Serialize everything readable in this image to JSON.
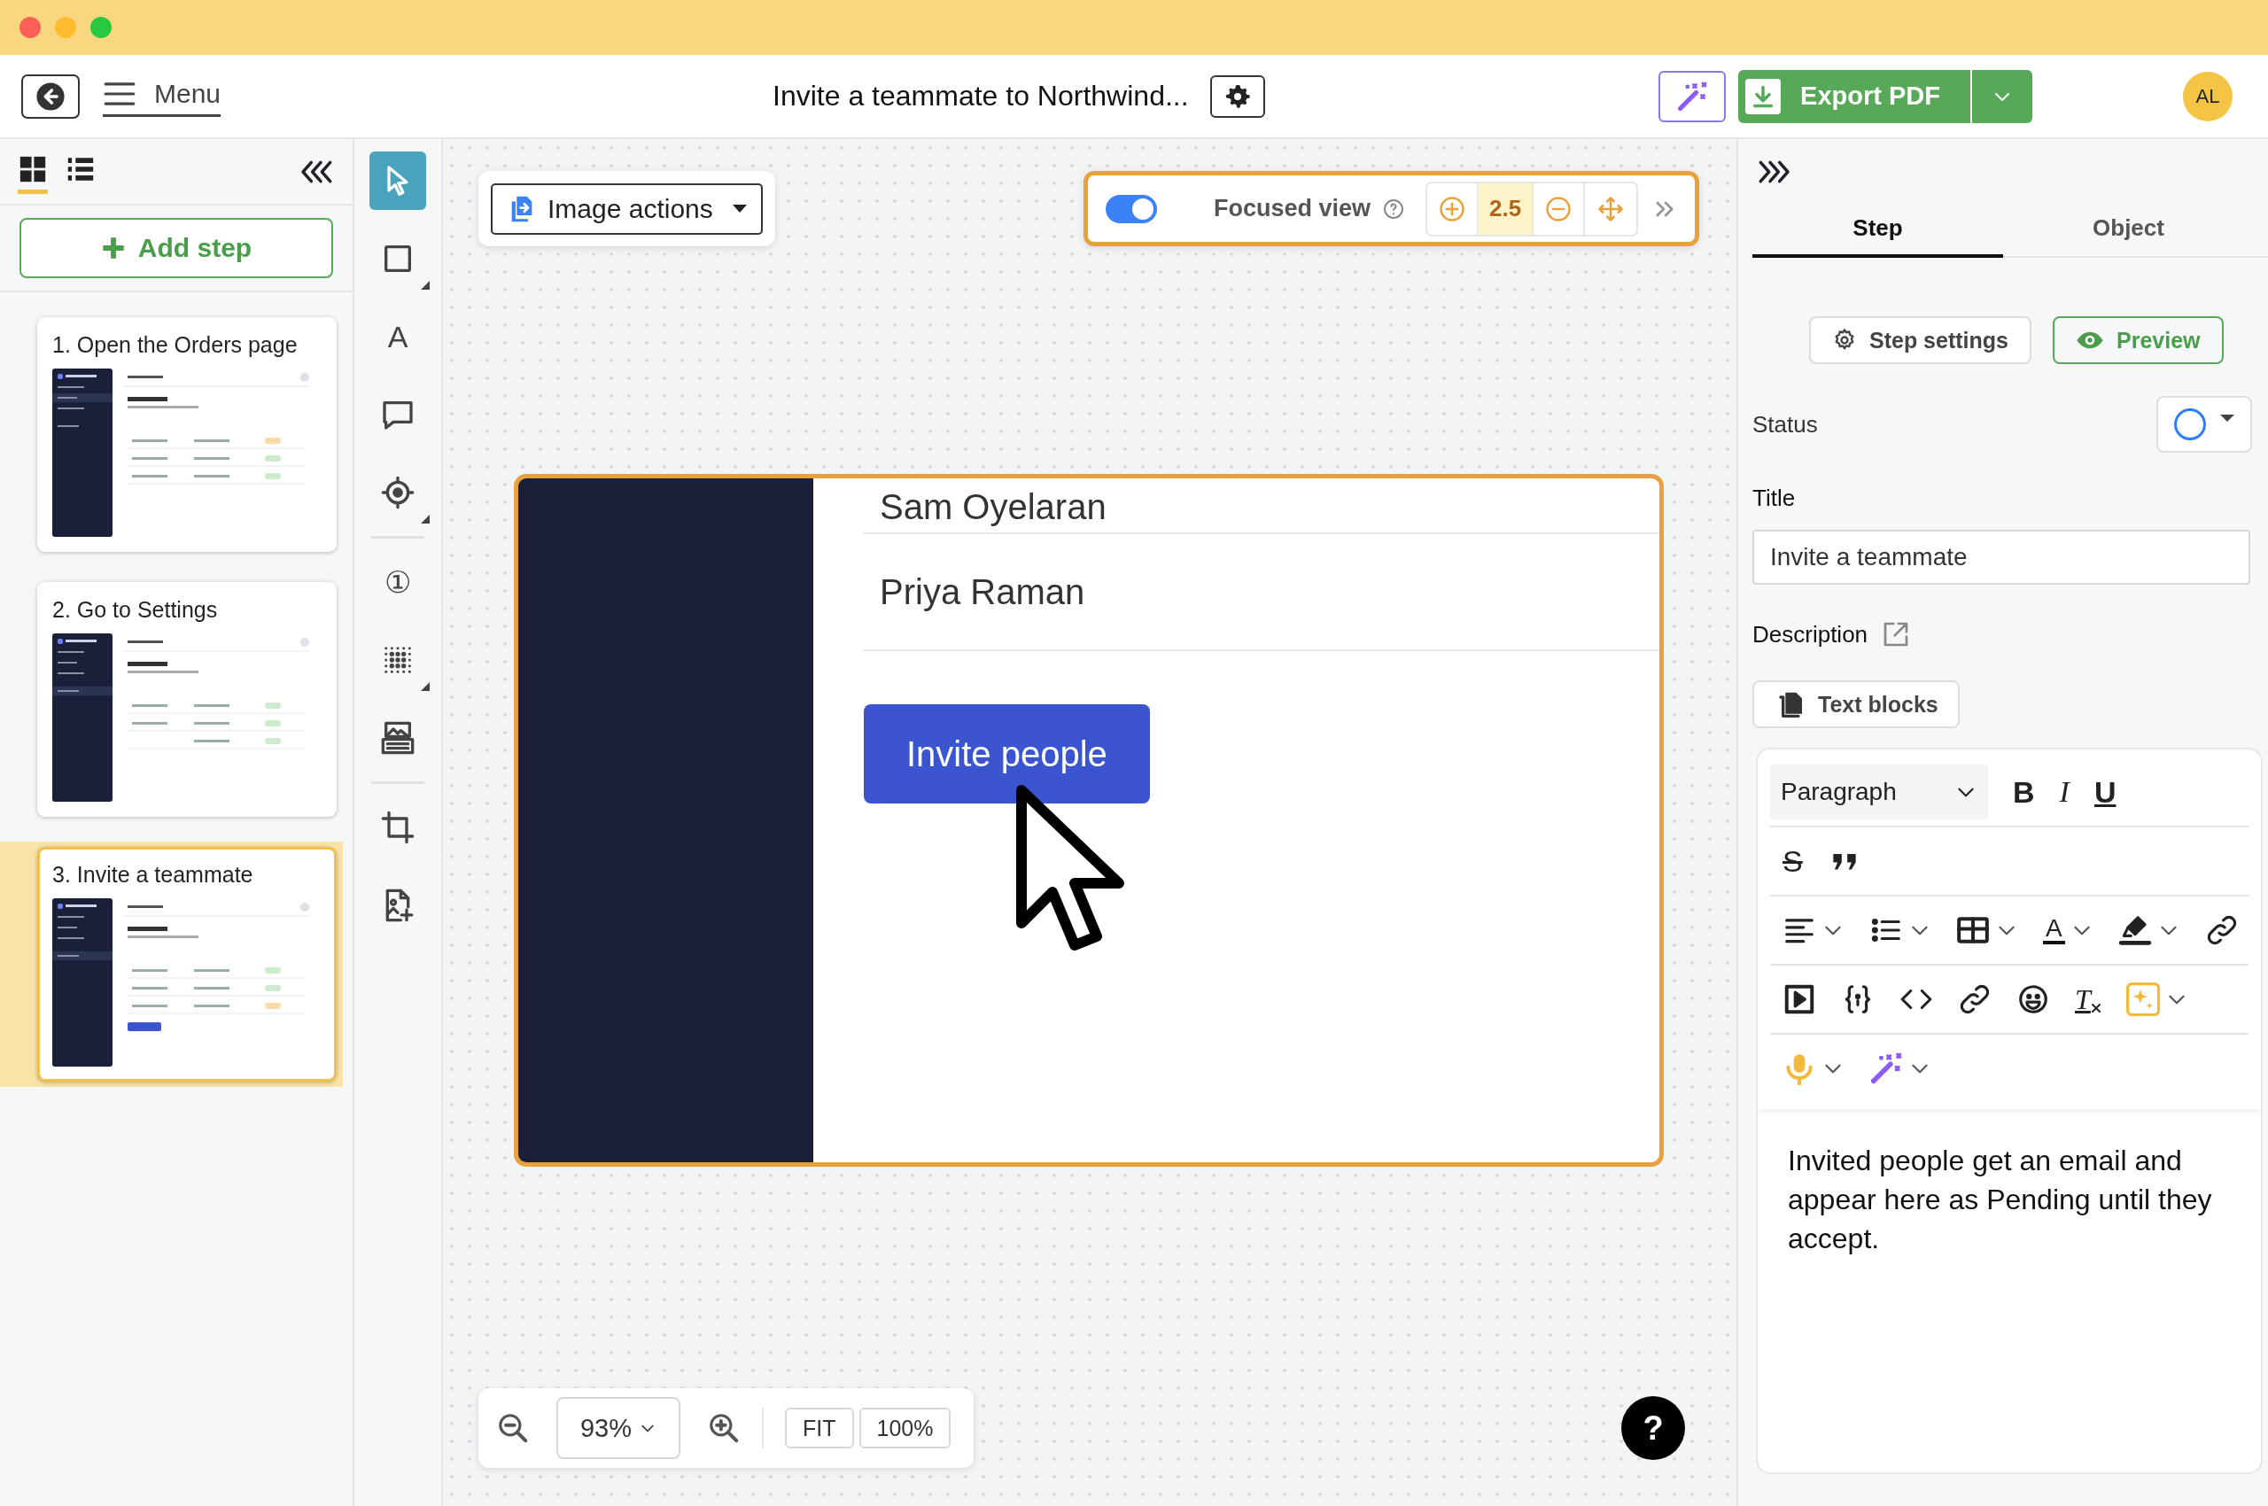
{
  "topbar": {
    "menu_label": "Menu",
    "title": "Invite a teammate to Northwind...",
    "export_label": "Export PDF",
    "avatar": "AL"
  },
  "left_panel": {
    "view_modes": [
      {
        "kind": "grid",
        "selected": true
      },
      {
        "kind": "list",
        "selected": false
      }
    ],
    "add_step": "Add step",
    "steps": [
      {
        "title": "1. Open the Orders page",
        "selected": false
      },
      {
        "title": "2. Go to Settings",
        "selected": false
      },
      {
        "title": "3. Invite a teammate",
        "selected": true
      }
    ]
  },
  "tools": [
    {
      "kind": "select",
      "selected": true,
      "submenu": false
    },
    {
      "kind": "rectangle",
      "selected": false,
      "submenu": true
    },
    {
      "kind": "text",
      "label": "A",
      "selected": false,
      "submenu": false
    },
    {
      "kind": "comment",
      "selected": false,
      "submenu": false
    },
    {
      "kind": "target",
      "selected": false,
      "submenu": true
    },
    {
      "kind": "divider"
    },
    {
      "kind": "step-number",
      "label": "①",
      "selected": false,
      "submenu": false
    },
    {
      "kind": "blur",
      "selected": false,
      "submenu": true
    },
    {
      "kind": "image-caption",
      "selected": false,
      "submenu": false
    },
    {
      "kind": "divider"
    },
    {
      "kind": "crop",
      "selected": false,
      "submenu": false
    },
    {
      "kind": "add-image",
      "selected": false,
      "submenu": false
    }
  ],
  "canvas": {
    "image_actions": "Image actions",
    "focused_view": {
      "on": true,
      "label": "Focused view",
      "zoom": "2.5"
    },
    "image": {
      "rows": [
        "Sam Oyelaran",
        "Priya Raman"
      ],
      "button": "Invite people"
    },
    "zoom_bar": {
      "zoom": "93%",
      "fit": "FIT",
      "full": "100%"
    },
    "help": "?"
  },
  "right_panel": {
    "tabs": [
      {
        "label": "Step",
        "selected": true
      },
      {
        "label": "Object",
        "selected": false
      }
    ],
    "step_settings": "Step settings",
    "preview": "Preview",
    "status_label": "Status",
    "title_label": "Title",
    "title_value": "Invite a teammate",
    "description_label": "Description",
    "text_blocks": "Text blocks",
    "editor": {
      "toolbar": [
        [
          {
            "kind": "block-style",
            "label": "Paragraph",
            "dropdown": true
          },
          {
            "kind": "bold",
            "label": "B",
            "dropdown": false
          },
          {
            "kind": "italic",
            "label": "I",
            "dropdown": false
          },
          {
            "kind": "underline",
            "label": "U",
            "dropdown": false
          }
        ],
        [
          {
            "kind": "strike",
            "label": "S",
            "dropdown": false
          },
          {
            "kind": "quote",
            "dropdown": false
          }
        ],
        [
          {
            "kind": "align",
            "dropdown": true
          },
          {
            "kind": "list",
            "dropdown": true
          },
          {
            "kind": "table",
            "dropdown": true
          },
          {
            "kind": "text-color",
            "label": "A",
            "dropdown": true
          },
          {
            "kind": "highlight",
            "dropdown": true
          },
          {
            "kind": "unlink",
            "dropdown": false
          }
        ],
        [
          {
            "kind": "video",
            "dropdown": false
          },
          {
            "kind": "variable",
            "dropdown": false
          },
          {
            "kind": "code",
            "dropdown": false
          },
          {
            "kind": "link",
            "dropdown": false
          },
          {
            "kind": "emoji",
            "dropdown": false
          },
          {
            "kind": "clear-format",
            "label": "T",
            "dropdown": false
          },
          {
            "kind": "ai",
            "dropdown": true
          }
        ],
        [
          {
            "kind": "mic",
            "dropdown": true
          },
          {
            "kind": "magic",
            "dropdown": true
          }
        ]
      ],
      "description": "Invited people get an email and appear here as Pending until they accept."
    }
  }
}
